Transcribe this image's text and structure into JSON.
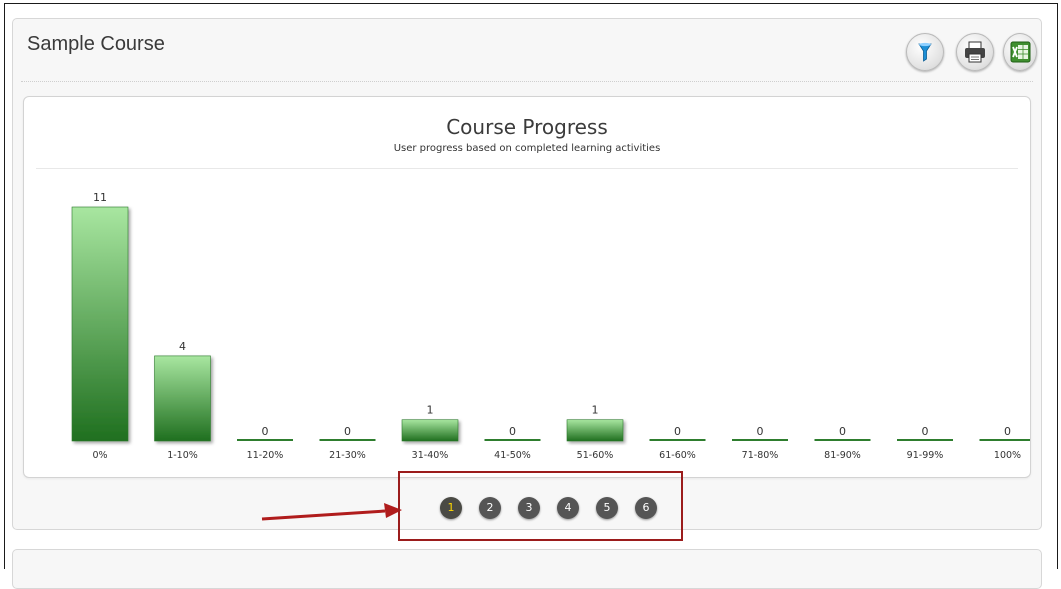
{
  "panel": {
    "title": "Sample Course",
    "icons": [
      "funnel-filter-icon",
      "printer-icon",
      "excel-export-icon"
    ]
  },
  "chart_data": {
    "type": "bar",
    "title": "Course Progress",
    "subtitle": "User progress based on completed learning activities",
    "categories": [
      "0%",
      "1-10%",
      "11-20%",
      "21-30%",
      "31-40%",
      "41-50%",
      "51-60%",
      "61-60%",
      "71-80%",
      "81-90%",
      "91-99%",
      "100%"
    ],
    "values": [
      11,
      4,
      0,
      0,
      1,
      0,
      1,
      0,
      0,
      0,
      0,
      0
    ],
    "ylim": [
      0,
      11
    ],
    "grid": false,
    "legend": "none",
    "colors": {
      "bar_light": "#a8e6a0",
      "bar_dark": "#1f6f1f",
      "zero_line": "#2e7d2e"
    }
  },
  "pager": {
    "pages": [
      "1",
      "2",
      "3",
      "4",
      "5",
      "6"
    ],
    "active_page": "1"
  },
  "annotation": {
    "arrow_color": "#b01c1c",
    "box_color": "#9b1c1c"
  }
}
